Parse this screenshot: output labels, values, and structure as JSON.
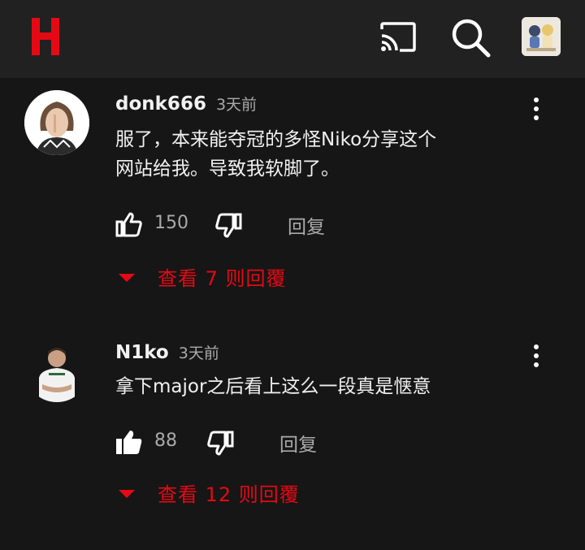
{
  "header": {
    "logo_icon": "h-logo-icon",
    "cast_icon": "cast-icon",
    "search_icon": "search-icon",
    "avatar_icon": "profile-avatar"
  },
  "colors": {
    "accent": "#e50914",
    "background": "#161616",
    "header_bg": "#212121",
    "muted_text": "#aaaaaa"
  },
  "comments": [
    {
      "author": "donk666",
      "time": "3天前",
      "text": "服了，本来能夺冠的多怪Niko分享这个\n网站给我。导致我软脚了。",
      "likes": "150",
      "reply_label": "回复",
      "view_replies": "查看 7 则回覆",
      "liked": false
    },
    {
      "author": "N1ko",
      "time": "3天前",
      "text": "拿下major之后看上这么一段真是惬意",
      "likes": "88",
      "reply_label": "回复",
      "view_replies": "查看 12 则回覆",
      "liked": true
    }
  ]
}
